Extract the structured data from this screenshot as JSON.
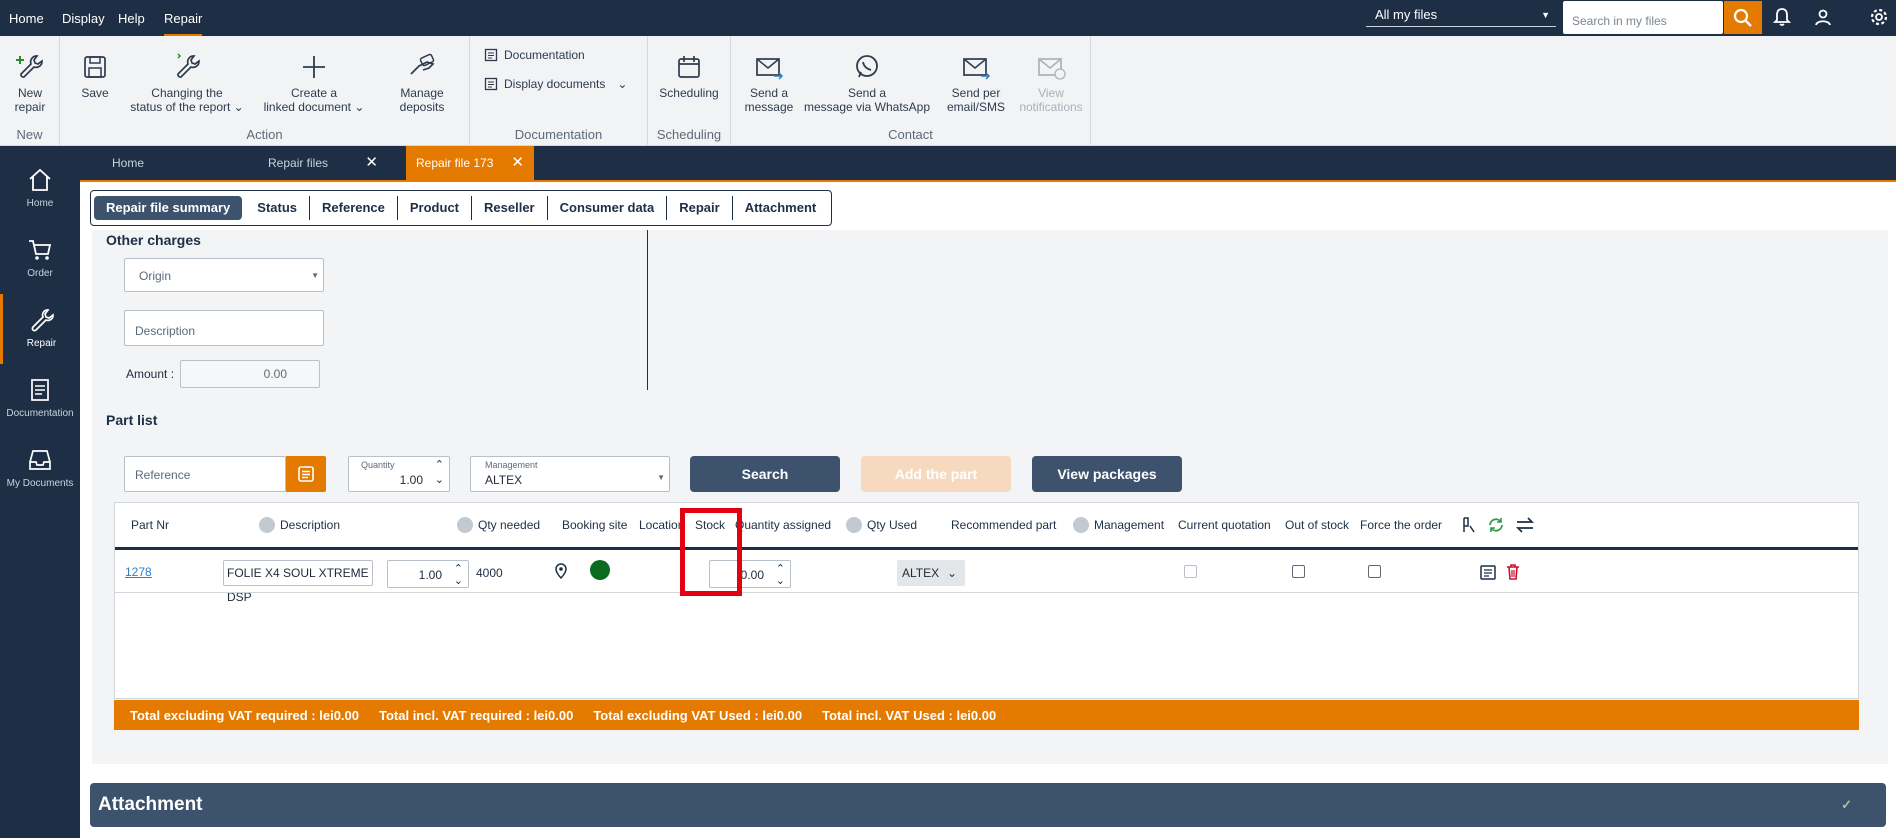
{
  "topmenu": [
    "Home",
    "Display",
    "Help",
    "Repair"
  ],
  "files_select": "All my files",
  "search_placeholder": "Search in my files",
  "ribbon": {
    "new_repair": [
      "New",
      "repair"
    ],
    "new_group": "New",
    "save": "Save",
    "change_status": [
      "Changing the",
      "status of the report"
    ],
    "create_linked": [
      "Create a",
      "linked document"
    ],
    "manage_deposits": [
      "Manage",
      "deposits"
    ],
    "action_group": "Action",
    "documentation": "Documentation",
    "display_documents": "Display documents",
    "documentation_group": "Documentation",
    "scheduling": "Scheduling",
    "scheduling_group": "Scheduling",
    "send_message": [
      "Send a",
      "message"
    ],
    "send_whatsapp": [
      "Send a",
      "message via WhatsApp"
    ],
    "send_email_sms": [
      "Send per",
      "email/SMS"
    ],
    "view_notifications": [
      "View",
      "notifications"
    ],
    "contact_group": "Contact"
  },
  "nav": [
    "Home",
    "Order",
    "Repair",
    "Documentation",
    "My Documents"
  ],
  "doctabs": [
    "Home",
    "Repair files",
    "Repair file 173"
  ],
  "sectabs": [
    "Repair file summary",
    "Status",
    "Reference",
    "Product",
    "Reseller",
    "Consumer data",
    "Repair",
    "Attachment"
  ],
  "other_charges": {
    "title": "Other charges",
    "origin": "Origin",
    "description": "Description",
    "amount_label": "Amount :",
    "amount_value": "0.00"
  },
  "part_list": {
    "title": "Part list",
    "reference_placeholder": "Reference",
    "quantity_label": "Quantity",
    "quantity_value": "1.00",
    "management_label": "Management",
    "management_value": "ALTEX",
    "search": "Search",
    "add_part": "Add the part",
    "view_packages": "View packages"
  },
  "table": {
    "headers": [
      "Part Nr",
      "Description",
      "Qty needed",
      "Booking site",
      "Location",
      "Stock",
      "Quantity assigned",
      "Qty Used",
      "Recommended part",
      "Management",
      "Current quotation",
      "Out of stock",
      "Force the order"
    ],
    "row": {
      "part_nr": "1278",
      "description": "FOLIE X4 SOUL XTREME DSP",
      "qty_needed": "1.00",
      "booking_site": "4000",
      "stock_status_color": "#0a6a1f",
      "qty_used": "0.00",
      "management": "ALTEX"
    }
  },
  "totals": [
    "Total excluding VAT required : lei0.00",
    "Total incl. VAT required : lei0.00",
    "Total excluding VAT Used : lei0.00",
    "Total incl. VAT Used : lei0.00"
  ],
  "attachment_title": "Attachment"
}
